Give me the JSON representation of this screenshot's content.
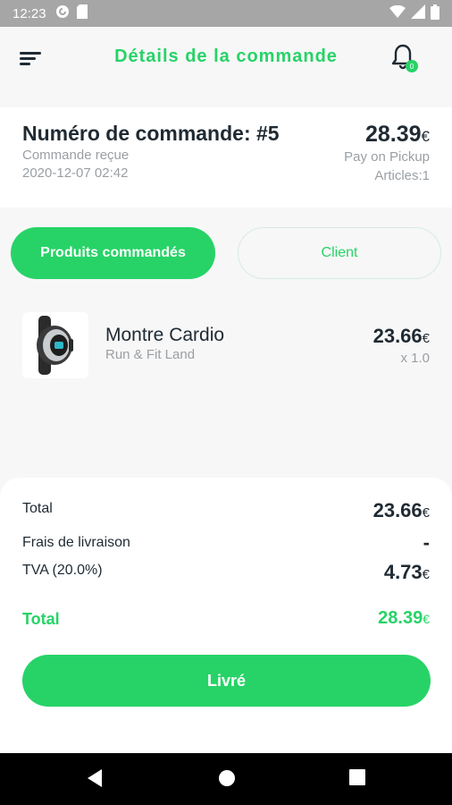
{
  "status_bar": {
    "time": "12:23",
    "icons": [
      "pocket-casts-icon",
      "sd-card-icon",
      "wifi-icon",
      "cellular-icon",
      "battery-icon"
    ]
  },
  "header": {
    "title": "Détails de la commande",
    "notification_badge": "0"
  },
  "order": {
    "number_label": "Numéro de commande: #5",
    "status": "Commande reçue",
    "date": "2020-12-07 02:42",
    "total_amount": "28.39",
    "currency": "€",
    "payment_method": "Pay on Pickup",
    "articles": "Articles:1"
  },
  "tabs": [
    {
      "label": "Produits commandés",
      "active": true
    },
    {
      "label": "Client",
      "active": false
    }
  ],
  "products": [
    {
      "name": "Montre Cardio",
      "vendor": "Run & Fit Land",
      "price": "23.66",
      "currency": "€",
      "quantity": "x 1.0",
      "image": "fitness-watch-image"
    }
  ],
  "summary": {
    "subtotal_label": "Total",
    "subtotal_value": "23.66",
    "delivery_label": "Frais de livraison",
    "delivery_value": "-",
    "tax_label": "TVA (20.0%)",
    "tax_value": "4.73",
    "grand_total_label": "Total",
    "grand_total_value": "28.39",
    "currency": "€"
  },
  "action": {
    "button_label": "Livré"
  },
  "colors": {
    "accent": "#27d367",
    "text_dark": "#1f2a33",
    "text_muted": "#9a9fa4",
    "background": "#f7f7f7"
  }
}
